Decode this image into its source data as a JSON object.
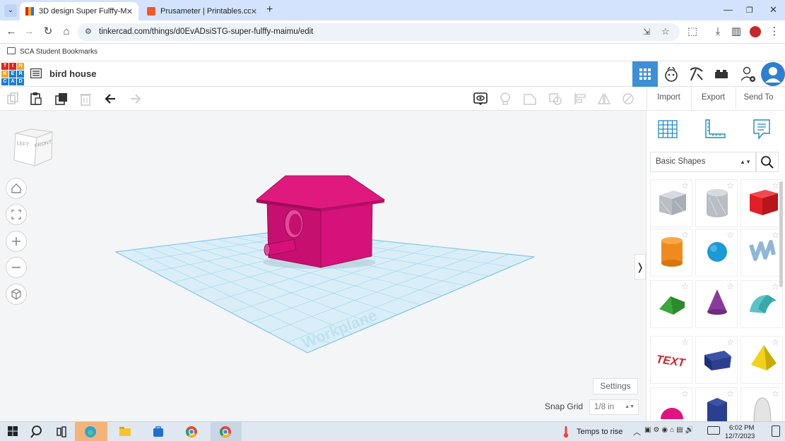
{
  "browser": {
    "tabs": [
      {
        "title": "3D design Super Fulffy-Maimu",
        "active": true
      },
      {
        "title": "Prusameter | Printables.com",
        "active": false
      }
    ],
    "new_tab": "+",
    "url": "tinkercad.com/things/d0EvADsiSTG-super-fulffy-maimu/edit",
    "bookmarks": [
      {
        "label": "SCA Student Bookmarks"
      }
    ]
  },
  "app": {
    "logo_letters": [
      "T",
      "I",
      "N",
      "K",
      "E",
      "R",
      "C",
      "A",
      "D"
    ],
    "design_name": "bird house"
  },
  "toolbar": {
    "import_label": "Import",
    "export_label": "Export",
    "send_to_label": "Send To"
  },
  "viewcube": {
    "left": "LEFT",
    "front": "FRONT"
  },
  "workplane": {
    "label": "Workplane"
  },
  "workspace": {
    "settings_label": "Settings",
    "snap_grid_label": "Snap Grid",
    "snap_grid_value": "1/8 in",
    "collapse_glyph": "❭"
  },
  "panel": {
    "category": "Basic Shapes",
    "shapes": [
      {
        "name": "Box Hole",
        "color": "#b7bcc4"
      },
      {
        "name": "Cylinder Hole",
        "color": "#b7bcc4"
      },
      {
        "name": "Box",
        "color": "#e21f26"
      },
      {
        "name": "Cylinder",
        "color": "#f08a1c"
      },
      {
        "name": "Sphere",
        "color": "#1a9ad6"
      },
      {
        "name": "Scribble",
        "color": "#8fb7d8"
      },
      {
        "name": "Roof",
        "color": "#3aa83b"
      },
      {
        "name": "Cone",
        "color": "#8a3a9e"
      },
      {
        "name": "Round Roof",
        "color": "#5bc2c8"
      },
      {
        "name": "Text",
        "color": "#d11f2c"
      },
      {
        "name": "Wedge",
        "color": "#2a3f8f"
      },
      {
        "name": "Pyramid",
        "color": "#f2d21a"
      },
      {
        "name": "Half Sphere",
        "color": "#e0137f"
      },
      {
        "name": "Polygon",
        "color": "#2a3f8f"
      },
      {
        "name": "Paraboloid",
        "color": "#cfcfcf"
      }
    ]
  },
  "taskbar": {
    "weather": "Temps to rise",
    "time": "6:02 PM",
    "date": "12/7/2023"
  },
  "colors": {
    "accent": "#3d8fd6",
    "model": "#d6127a",
    "grid": "#a9d8ec"
  }
}
